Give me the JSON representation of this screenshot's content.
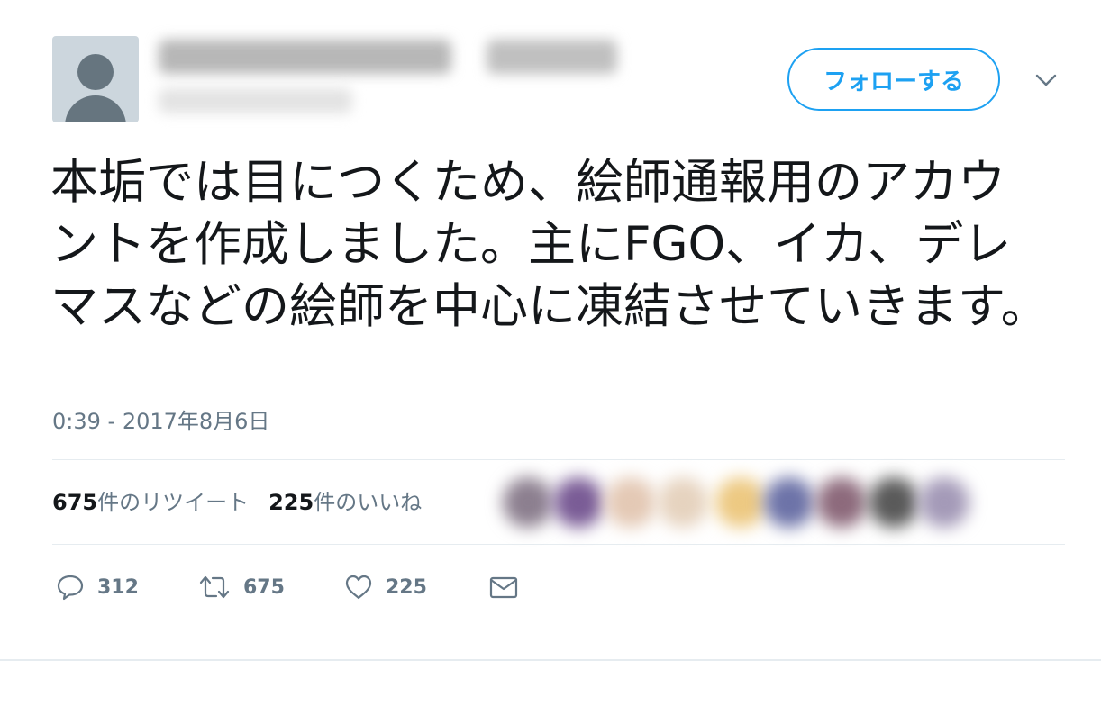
{
  "header": {
    "follow_label": "フォローする",
    "more_icon": "chevron-down-icon"
  },
  "tweet": {
    "text": "本垢では目につくため、絵師通報用のアカウントを作成しました。主にFGO、イカ、デレマスなどの絵師を中心に凍結させていきます。",
    "timestamp": "0:39 - 2017年8月6日"
  },
  "stats": {
    "retweets_count": "675",
    "retweets_label": "件のリツイート",
    "likes_count": "225",
    "likes_label": "件のいいね"
  },
  "actions": {
    "reply_count": "312",
    "retweet_count": "675",
    "like_count": "225"
  },
  "colors": {
    "accent": "#1da1f2",
    "muted": "#657786",
    "text": "#14171a",
    "divider": "#e6ecf0"
  }
}
